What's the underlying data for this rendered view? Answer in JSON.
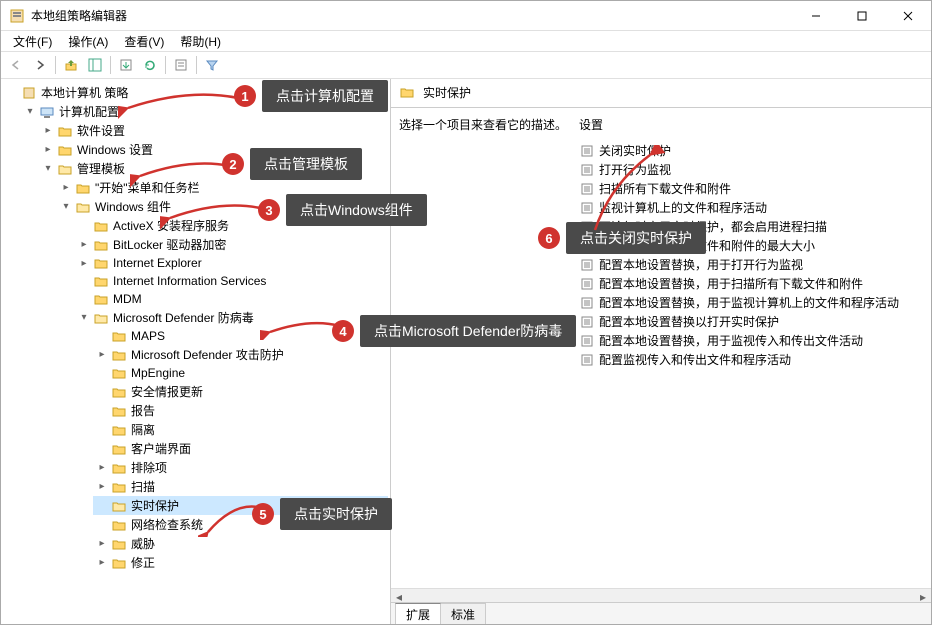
{
  "title": "本地组策略编辑器",
  "menu": [
    "文件(F)",
    "操作(A)",
    "查看(V)",
    "帮助(H)"
  ],
  "tree": {
    "root": "本地计算机 策略",
    "l1": "计算机配置",
    "l1_children": [
      "软件设置",
      "Windows 设置"
    ],
    "mgmt": "管理模板",
    "start_menu": "\"开始\"菜单和任务栏",
    "win_comp": "Windows 组件",
    "wc_pre": [
      "ActiveX 安装程序服务",
      "BitLocker 驱动器加密",
      "Internet Explorer",
      "Internet Information Services",
      "MDM"
    ],
    "defender": "Microsoft Defender 防病毒",
    "def_children": [
      "MAPS",
      "Microsoft Defender 攻击防护",
      "MpEngine",
      "安全情报更新",
      "报告",
      "隔离",
      "客户端界面",
      "排除项",
      "扫描",
      "实时保护",
      "网络检查系统",
      "威胁",
      "修正"
    ]
  },
  "detail": {
    "crumb": "实时保护",
    "desc_prompt": "选择一个项目来查看它的描述。",
    "col_setting": "设置",
    "settings": [
      "关闭实时保护",
      "打开行为监视",
      "扫描所有下载文件和附件",
      "监视计算机上的文件和程序活动",
      "不论何时启用实时保护，都会启用进程扫描",
      "定义要扫描的下载文件和附件的最大大小",
      "配置本地设置替换，用于打开行为监视",
      "配置本地设置替换，用于扫描所有下载文件和附件",
      "配置本地设置替换，用于监视计算机上的文件和程序活动",
      "配置本地设置替换以打开实时保护",
      "配置本地设置替换，用于监视传入和传出文件活动",
      "配置监视传入和传出文件和程序活动"
    ],
    "tabs": [
      "扩展",
      "标准"
    ]
  },
  "callouts": [
    {
      "n": "1",
      "text": "点击计算机配置"
    },
    {
      "n": "2",
      "text": "点击管理模板"
    },
    {
      "n": "3",
      "text": "点击Windows组件"
    },
    {
      "n": "4",
      "text": "点击Microsoft Defender防病毒"
    },
    {
      "n": "5",
      "text": "点击实时保护"
    },
    {
      "n": "6",
      "text": "点击关闭实时保护"
    }
  ]
}
